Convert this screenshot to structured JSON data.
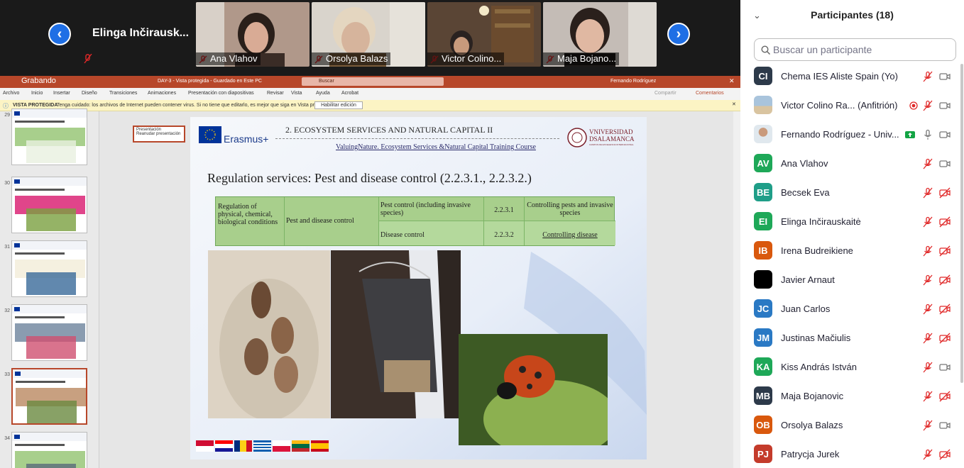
{
  "video_strip": {
    "active_speaker": "Elinga  Inčirausk...",
    "tiles": [
      {
        "name": "Ana Vlahov",
        "bg": "#a68f80"
      },
      {
        "name": "Orsolya Balazs",
        "bg": "#c9b8a4"
      },
      {
        "name": "Victor Colino...",
        "bg": "#5e4a3c"
      },
      {
        "name": "Maja Bojano...",
        "bg": "#b4aaa3"
      }
    ],
    "prev_icon": "chevron-left-icon",
    "next_icon": "chevron-right-icon"
  },
  "ppt": {
    "window_title": "DAY-3  -  Vista protegida  -  Guardado en Este PC",
    "search_placeholder": "Buscar",
    "user": "Fernando Rodríguez",
    "recording": "Grabando",
    "menu": [
      "Archivo",
      "Inicio",
      "Insertar",
      "Diseño",
      "Transiciones",
      "Animaciones",
      "Presentación con diapositivas",
      "Revisar",
      "Vista",
      "Ayuda",
      "Acrobat"
    ],
    "share": "Compartir",
    "comments": "Comentarios",
    "protected_label": "VISTA PROTEGIDA",
    "protected_msg": "Tenga cuidado: los archivos de Internet pueden contener virus. Si no tiene que editarlo, es mejor que siga en Vista protegida.",
    "enable_edit": "Habilitar edición",
    "thumb_numbers": [
      "29",
      "30",
      "31",
      "32",
      "33",
      "34"
    ],
    "popup": {
      "title": "Presentación",
      "action": "Reanudar presentación"
    }
  },
  "slide": {
    "erasmus": "Erasmus+",
    "header_title": "2. ECOSYSTEM SERVICES AND NATURAL CAPITAL II",
    "header_sub": "ValuingNature. Ecosystem Services &Natural Capital Training Course",
    "univ1": "VNIVERSIDAD",
    "univ2": "DSALAMANCA",
    "univ3": "CAMPUS DE EXCELENCIA INTERNACIONAL",
    "title": "Regulation services: Pest and disease control (2.2.3.1., 2.2.3.2.)",
    "table": {
      "c1": "Regulation of physical, chemical, biological conditions",
      "c2": "Pest and disease control",
      "r1": [
        "Pest control (including invasive species)",
        "2.2.3.1",
        "Controlling pests and invasive species"
      ],
      "r2": [
        "Disease control",
        "2.2.3.2",
        "Controlling disease"
      ]
    }
  },
  "participants": {
    "title": "Participantes (18)",
    "search_placeholder": "Buscar un participante",
    "list": [
      {
        "initials": "CI",
        "name": "Chema IES Aliste Spain (Yo)",
        "color": "#2d3a4a"
      },
      {
        "initials": "",
        "name": "Victor Colino Ra...  (Anfitrión)",
        "color": "#9ab4c8"
      },
      {
        "initials": "",
        "name": "Fernando Rodríguez - Univ...",
        "color": "#7a9fb8"
      },
      {
        "initials": "AV",
        "name": "Ana Vlahov",
        "color": "#1ea858"
      },
      {
        "initials": "BE",
        "name": "Becsek Eva",
        "color": "#1f9e88"
      },
      {
        "initials": "EI",
        "name": "Elinga Inčirauskaitė",
        "color": "#1ea858"
      },
      {
        "initials": "IB",
        "name": "Irena Budreikiene",
        "color": "#d9580d"
      },
      {
        "initials": "",
        "name": "Javier Arnaut",
        "color": "#000000"
      },
      {
        "initials": "JC",
        "name": "Juan Carlos",
        "color": "#2a79c4"
      },
      {
        "initials": "JM",
        "name": "Justinas Mačiulis",
        "color": "#2a79c4"
      },
      {
        "initials": "KA",
        "name": "Kiss András István",
        "color": "#1ea858"
      },
      {
        "initials": "MB",
        "name": "Maja Bojanovic",
        "color": "#2d3a4a"
      },
      {
        "initials": "OB",
        "name": "Orsolya Balazs",
        "color": "#d9580d"
      },
      {
        "initials": "PJ",
        "name": "Patrycja Jurek",
        "color": "#c43b2b"
      }
    ]
  }
}
